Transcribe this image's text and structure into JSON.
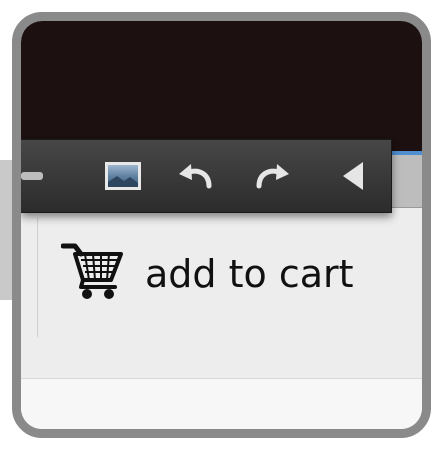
{
  "toolbar": {
    "buttons": [
      {
        "name": "dash-icon"
      },
      {
        "name": "image-icon"
      },
      {
        "name": "undo-icon"
      },
      {
        "name": "redo-icon"
      },
      {
        "name": "arrow-left-icon"
      }
    ]
  },
  "cart": {
    "label": "add to cart",
    "icon": "shopping-cart-icon"
  },
  "colors": {
    "frame_border": "#8a8a8a",
    "header_dark": "#1c1010",
    "accent_blue": "#4f8ed0",
    "toolbar_bg": "#333333"
  }
}
